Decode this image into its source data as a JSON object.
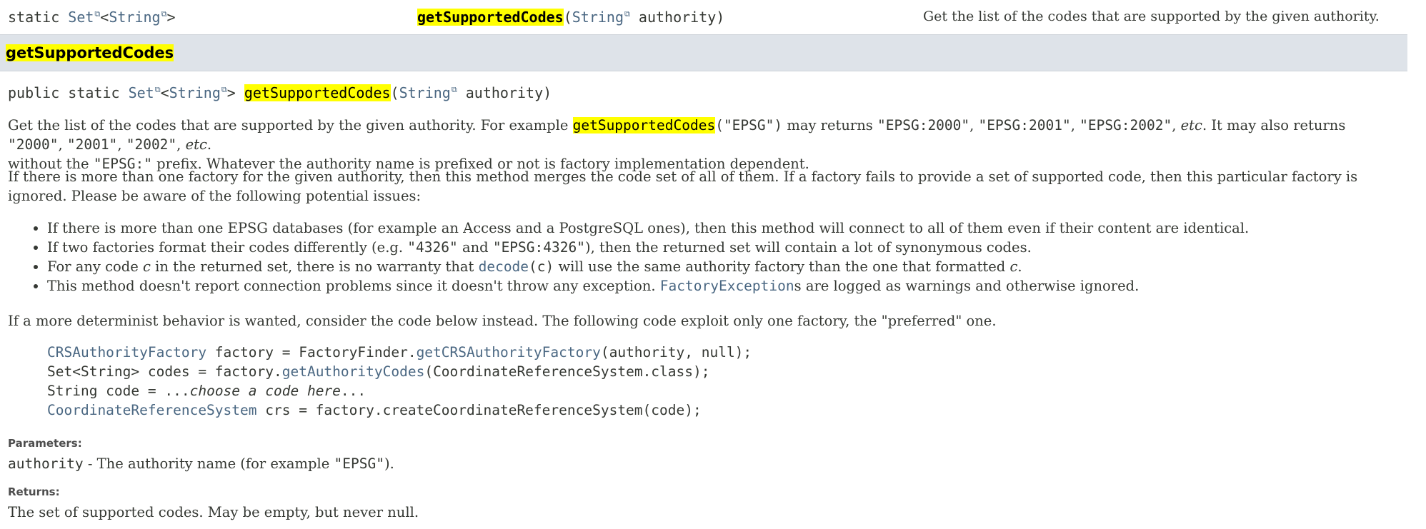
{
  "summary": {
    "modifier": "static",
    "return_type_outer": "Set",
    "return_type_inner": "String",
    "method_name": "getSupportedCodes",
    "param_type": "String",
    "param_name": "authority",
    "description": "Get the list of the codes that are supported by the given authority."
  },
  "detail": {
    "heading": "getSupportedCodes",
    "signature": {
      "modifiers": "public static",
      "return_type_outer": "Set",
      "return_type_inner": "String",
      "method_name": "getSupportedCodes",
      "param_type": "String",
      "param_name": "authority"
    },
    "para1": {
      "a": "Get the list of the codes that are supported by the given authority. For example ",
      "code_name": "getSupportedCodes",
      "code_arg": "(\"EPSG\")",
      "b": " may returns ",
      "c1": "\"EPSG:2000\"",
      "c2": "\"EPSG:2001\"",
      "c3": "\"EPSG:2002\"",
      "etc": "etc",
      "d": ". It may also returns ",
      "c4": "\"2000\"",
      "c5": "\"2001\"",
      "c6": "\"2002\"",
      "e": "without the ",
      "c7": "\"EPSG:\"",
      "f": " prefix. Whatever the authority name is prefixed or not is factory implementation dependent."
    },
    "para2": "If there is more than one factory for the given authority, then this method merges the code set of all of them. If a factory fails to provide a set of supported code, then this particular factory is ignored. Please be aware of the following potential issues:",
    "bullets": {
      "b1": "If there is more than one EPSG databases (for example an Access and a PostgreSQL ones), then this method will connect to all of them even if their content are identical.",
      "b2a": "If two factories format their codes differently (e.g. ",
      "b2c1": "\"4326\"",
      "b2b": " and ",
      "b2c2": "\"EPSG:4326\"",
      "b2c": "), then the returned set will contain a lot of synonymous codes.",
      "b3a": "For any code ",
      "b3v": "c",
      "b3b": " in the returned set, there is no warranty that ",
      "b3code": "decode",
      "b3arg": "(c)",
      "b3c": " will use the same authority factory than the one that formatted ",
      "b3v2": "c",
      "b3d": ".",
      "b4a": "This method doesn't report connection problems since it doesn't throw any exception. ",
      "b4link": "FactoryException",
      "b4b": "s are logged as warnings and otherwise ignored."
    },
    "para3": "If a more determinist behavior is wanted, consider the code below instead. The following code exploit only one factory, the \"preferred\" one.",
    "code": {
      "l1_type": "CRSAuthorityFactory",
      "l1_mid": " factory = FactoryFinder.",
      "l1_method": "getCRSAuthorityFactory",
      "l1_end": "(authority, null);",
      "l2_start": "Set<String> codes = factory.",
      "l2_method": "getAuthorityCodes",
      "l2_end": "(CoordinateReferenceSystem.class);",
      "l3_start": "String code = ...",
      "l3_italic": "choose a code here",
      "l3_end": "...",
      "l4_type": "CoordinateReferenceSystem",
      "l4_end": " crs = factory.createCoordinateReferenceSystem(code);"
    },
    "parameters_label": "Parameters:",
    "param_name": "authority",
    "param_desc_a": " - The authority name (for example ",
    "param_desc_code": "\"EPSG\"",
    "param_desc_b": ").",
    "returns_label": "Returns:",
    "returns_text": "The set of supported codes. May be empty, but never null."
  },
  "icons": {
    "external_link": "external-link-icon"
  },
  "colors": {
    "highlight": "#ffff00",
    "header_bg": "#dee3e9",
    "link": "#4a6782"
  }
}
